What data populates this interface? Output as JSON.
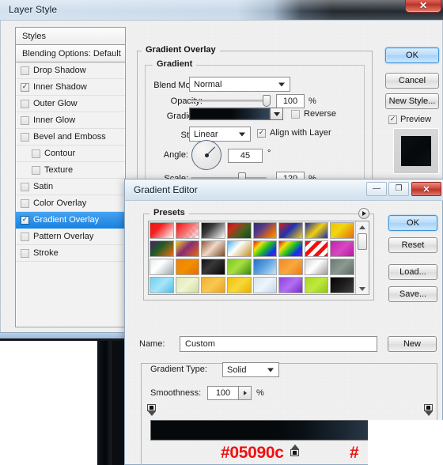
{
  "layer_style": {
    "title": "Layer Style",
    "close_glyph": "✕",
    "styles_header": "Styles",
    "blending_options": "Blending Options: Default",
    "effects": [
      {
        "label": "Drop Shadow",
        "checked": false,
        "indent": false,
        "selected": false
      },
      {
        "label": "Inner Shadow",
        "checked": true,
        "indent": false,
        "selected": false
      },
      {
        "label": "Outer Glow",
        "checked": false,
        "indent": false,
        "selected": false
      },
      {
        "label": "Inner Glow",
        "checked": false,
        "indent": false,
        "selected": false
      },
      {
        "label": "Bevel and Emboss",
        "checked": false,
        "indent": false,
        "selected": false
      },
      {
        "label": "Contour",
        "checked": false,
        "indent": true,
        "selected": false
      },
      {
        "label": "Texture",
        "checked": false,
        "indent": true,
        "selected": false
      },
      {
        "label": "Satin",
        "checked": false,
        "indent": false,
        "selected": false
      },
      {
        "label": "Color Overlay",
        "checked": false,
        "indent": false,
        "selected": false
      },
      {
        "label": "Gradient Overlay",
        "checked": true,
        "indent": false,
        "selected": true
      },
      {
        "label": "Pattern Overlay",
        "checked": false,
        "indent": false,
        "selected": false
      },
      {
        "label": "Stroke",
        "checked": false,
        "indent": false,
        "selected": false
      }
    ],
    "buttons": {
      "ok": "OK",
      "cancel": "Cancel",
      "new_style": "New Style...",
      "preview": "Preview"
    },
    "gradient_overlay": {
      "group_title": "Gradient Overlay",
      "sub_group_title": "Gradient",
      "blend_mode_label": "Blend Mode:",
      "blend_mode_value": "Normal",
      "opacity_label": "Opacity:",
      "opacity_value": "100",
      "opacity_unit": "%",
      "gradient_label": "Gradient:",
      "reverse_label": "Reverse",
      "reverse_checked": false,
      "style_label": "Style:",
      "style_value": "Linear",
      "align_label": "Align with Layer",
      "align_checked": true,
      "angle_label": "Angle:",
      "angle_value": "45",
      "angle_unit": "°",
      "scale_label": "Scale:",
      "scale_value": "120",
      "scale_unit": "%"
    }
  },
  "gradient_editor": {
    "title": "Gradient Editor",
    "window_buttons": {
      "minimize": "—",
      "maximize": "❐",
      "close": "✕"
    },
    "presets_label": "Presets",
    "buttons": {
      "ok": "OK",
      "reset": "Reset",
      "load": "Load...",
      "save": "Save...",
      "new": "New"
    },
    "name_label": "Name:",
    "name_value": "Custom",
    "gradient_type_label": "Gradient Type:",
    "gradient_type_value": "Solid",
    "smoothness_label": "Smoothness:",
    "smoothness_value": "100",
    "smoothness_unit": "%",
    "presets": [
      "linear-gradient(135deg,#f01010 0%,#f42020 35%,#ffffff 100%)",
      "linear-gradient(135deg,#f01010 0%,#f86a6a 45%,rgba(255,255,255,0) 100%),repeating-conic-gradient(#d8d8d8 0% 25%,#ffffff 0% 50%) 0 0/8px 8px",
      "linear-gradient(135deg,#101010 0%,#3a3a3a 35%,#ffffff 100%)",
      "linear-gradient(135deg,#a81818 0%,#c03020 25%,#4a6020 60%,#0e4a18 100%)",
      "linear-gradient(135deg,#2a2f6a 0%,#5a3a8a 35%,#e06a10 75%,#f0a010 100%)",
      "linear-gradient(135deg,#d02018 0%,#2030b0 45%,#f0d010 100%)",
      "linear-gradient(135deg,#1a2aa8 0%,#f0d010 50%,#1a2aa8 100%)",
      "linear-gradient(135deg,#f0c000 0%,#f0d810 40%,#e86a10 100%)",
      "linear-gradient(135deg,#4a2068 0%,#1c5a28 40%,#f07010 100%)",
      "linear-gradient(135deg,#f0d010 0%,#8a2a78 45%,#e86a10 100%)",
      "linear-gradient(135deg,#8a5a38 0%,#f0d8c8 45%,#7a4a28 100%)",
      "linear-gradient(135deg,#40b0f0 0%,#ffffff 40%,#c09020 100%)",
      "linear-gradient(135deg,#f01010 0%,#f0e010 25%,#20c020 50%,#1030f0 80%,#8020c0 100%)",
      "linear-gradient(135deg,#f01010,#f0e010,#20c020,#1030f0,#8020c0)",
      "repeating-linear-gradient(135deg,#f01010 0 5px,#ffffff 5px 10px)",
      "linear-gradient(135deg,#c020b0 0%,#d848c0 50%,#b818a0 100%)",
      "linear-gradient(135deg,#e8eef2 0%,#ffffff 40%,#9aa8b0 100%)",
      "linear-gradient(135deg,#f08000 0%,#f09000 50%,#e86a00 100%)",
      "linear-gradient(135deg,#101010 0%,#383838 40%,#050505 100%)",
      "linear-gradient(135deg,#7ac820 0%,#a8e040 45%,#3a8810 100%)",
      "linear-gradient(135deg,#2a70c0 0%,#5aa0e0 45%,#c8e4f4 100%)",
      "linear-gradient(135deg,#f08820 0%,#f8a840 50%,#f07810 100%)",
      "linear-gradient(135deg,#d8d8d8 0%,#ffffff 45%,#9a9a9a 100%)",
      "linear-gradient(135deg,#6a7a70 0%,#8a9a90 50%,#5a6a60 100%)",
      "linear-gradient(135deg,#70d0f0 0%,#a8e4f8 50%,#50bce8 100%)",
      "linear-gradient(135deg,#e0e8b8 0%,#f0f4d0 50%,#d0d8a0 100%)",
      "linear-gradient(135deg,#f0b030 0%,#f8c850 50%,#e8a020 100%)",
      "linear-gradient(135deg,#f0c010 0%,#f8d838 50%,#e8b000 100%)",
      "linear-gradient(135deg,#d8e4f0 0%,#eef4fa 50%,#c0d4e8 100%)",
      "linear-gradient(135deg,#9040e0 0%,#b070f0 50%,#7828c8 100%)",
      "linear-gradient(135deg,#a8d820 0%,#c0e840 50%,#90c810 100%)",
      "linear-gradient(135deg,#050505 0%,#1a1a1a 45%,#404040 100%)"
    ],
    "gradient_bar": {
      "stops_top": [
        "left",
        "right"
      ],
      "stop_bottom_positions": [
        "middle"
      ]
    }
  },
  "annotations": {
    "hex_left": "#05090c",
    "hex_right": "#"
  },
  "colors": {
    "accent_blue": "#1b82e0",
    "annotation_red": "#f01010",
    "gradient_dark": "#05090c"
  }
}
